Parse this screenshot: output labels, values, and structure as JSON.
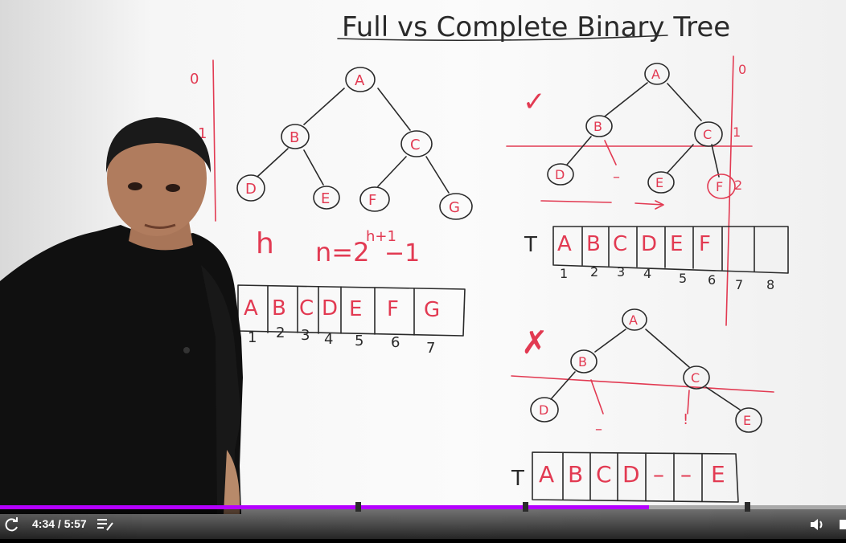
{
  "board": {
    "title": "Full vs Complete Binary Tree",
    "tree1": {
      "nodes": [
        "A",
        "B",
        "C",
        "D",
        "E",
        "F",
        "G"
      ],
      "levels": [
        "0",
        "1"
      ]
    },
    "formula": {
      "h": "h",
      "lhs": "n=2",
      "exp": "h+1",
      "rhs": "−1"
    },
    "array1": {
      "cells": [
        "A",
        "B",
        "C",
        "D",
        "E",
        "F",
        "G"
      ],
      "indices": [
        "1",
        "2",
        "3",
        "4",
        "5",
        "6",
        "7"
      ]
    },
    "tree2": {
      "mark": "✓",
      "nodes": [
        "A",
        "B",
        "C",
        "D",
        "E",
        "F"
      ],
      "levels": [
        "0",
        "1",
        "2"
      ],
      "dash": "–"
    },
    "array2": {
      "label": "T",
      "cells": [
        "A",
        "B",
        "C",
        "D",
        "E",
        "F",
        "",
        ""
      ],
      "indices": [
        "1",
        "2",
        "3",
        "4",
        "5",
        "6",
        "7",
        "8"
      ]
    },
    "tree3": {
      "mark": "✗",
      "nodes": [
        "A",
        "B",
        "C",
        "D",
        "E"
      ],
      "dash1": "–",
      "dash2": "!"
    },
    "array3": {
      "label": "T",
      "cells": [
        "A",
        "B",
        "C",
        "D",
        "–",
        "–",
        "E"
      ],
      "indices": [
        "1",
        "2",
        "3",
        "4",
        "5",
        "6",
        "7"
      ]
    }
  },
  "player": {
    "current_time": "4:34",
    "duration": "5:57",
    "time_display": "4:34 / 5:57",
    "progress": 0.767,
    "accent": "#b400ff",
    "chapter_markers": [
      0.42,
      0.618,
      0.88
    ],
    "icons": [
      "replay-icon",
      "chapters-icon",
      "volume-icon"
    ]
  }
}
